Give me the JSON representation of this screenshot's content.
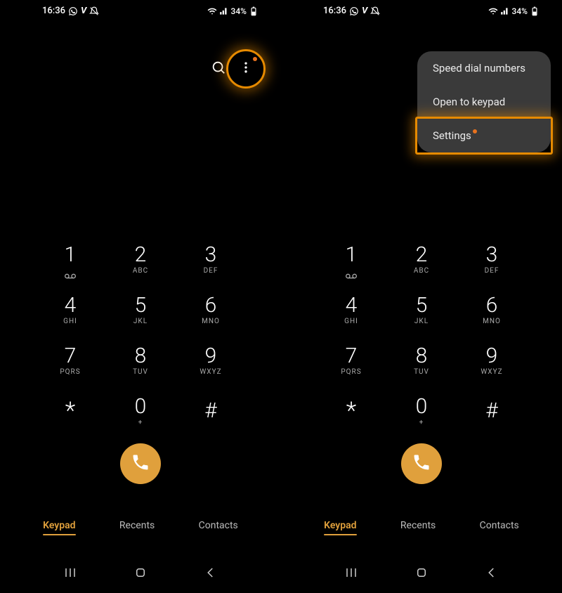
{
  "status": {
    "time": "16:36",
    "battery": "34%"
  },
  "keypad": {
    "keys": [
      {
        "digit": "1",
        "letters": "voicemail"
      },
      {
        "digit": "2",
        "letters": "ABC"
      },
      {
        "digit": "3",
        "letters": "DEF"
      },
      {
        "digit": "4",
        "letters": "GHI"
      },
      {
        "digit": "5",
        "letters": "JKL"
      },
      {
        "digit": "6",
        "letters": "MNO"
      },
      {
        "digit": "7",
        "letters": "PQRS"
      },
      {
        "digit": "8",
        "letters": "TUV"
      },
      {
        "digit": "9",
        "letters": "WXYZ"
      },
      {
        "digit": "*",
        "letters": ""
      },
      {
        "digit": "0",
        "letters": "+"
      },
      {
        "digit": "#",
        "letters": ""
      }
    ]
  },
  "tabs": {
    "keypad": "Keypad",
    "recents": "Recents",
    "contacts": "Contacts"
  },
  "menu": {
    "speed_dial": "Speed dial numbers",
    "open_keypad": "Open to keypad",
    "settings": "Settings"
  },
  "colors": {
    "accent": "#E0A03C",
    "highlight": "#E68A00"
  }
}
